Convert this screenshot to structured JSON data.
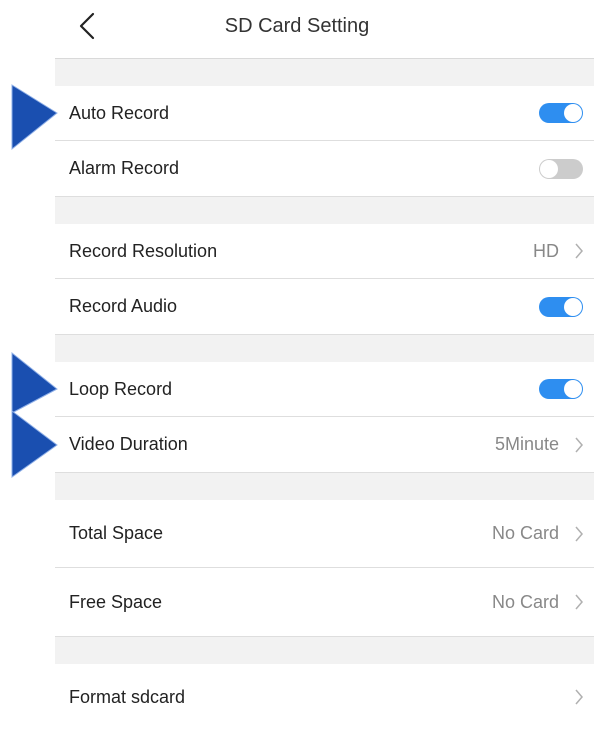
{
  "header": {
    "title": "SD Card Setting",
    "back_icon": "chevron-left-icon"
  },
  "colors": {
    "toggle_on": "#2e8ef0",
    "toggle_off": "#cccccc",
    "pointer": "#1a4fb0"
  },
  "settings": {
    "auto_record": {
      "label": "Auto Record",
      "enabled": true
    },
    "alarm_record": {
      "label": "Alarm Record",
      "enabled": false
    },
    "record_resolution": {
      "label": "Record Resolution",
      "value": "HD"
    },
    "record_audio": {
      "label": "Record Audio",
      "enabled": true
    },
    "loop_record": {
      "label": "Loop Record",
      "enabled": true
    },
    "video_duration": {
      "label": "Video Duration",
      "value": "5Minute"
    },
    "total_space": {
      "label": "Total Space",
      "value": "No Card"
    },
    "free_space": {
      "label": "Free Space",
      "value": "No Card"
    },
    "format_sdcard": {
      "label": "Format sdcard"
    }
  }
}
